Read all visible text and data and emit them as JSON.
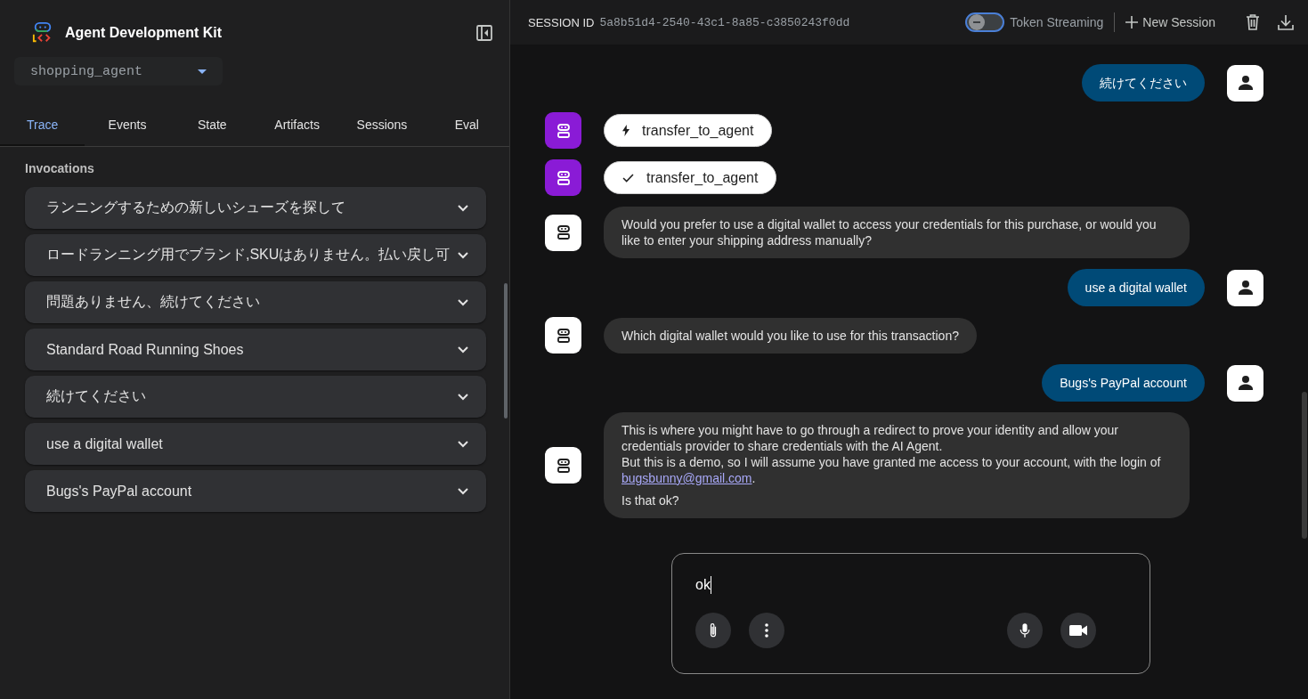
{
  "sidebar": {
    "title": "Agent Development Kit",
    "agent_select": {
      "value": "shopping_agent"
    },
    "tabs": [
      {
        "label": "Trace",
        "selected": true
      },
      {
        "label": "Events",
        "selected": false
      },
      {
        "label": "State",
        "selected": false
      },
      {
        "label": "Artifacts",
        "selected": false
      },
      {
        "label": "Sessions",
        "selected": false
      },
      {
        "label": "Eval",
        "selected": false
      }
    ],
    "section_title": "Invocations",
    "invocations": [
      {
        "label": "ランニングするための新しいシューズを探して",
        "expanded": false
      },
      {
        "label": "ロードランニング用でブランド,SKUはありません。払い戻し可",
        "expanded": false
      },
      {
        "label": "問題ありません、続けてください",
        "expanded": false
      },
      {
        "label": "Standard Road Running Shoes",
        "expanded": false
      },
      {
        "label": "続けてください",
        "expanded": false
      },
      {
        "label": "use a digital wallet",
        "expanded": false
      },
      {
        "label": "Bugs's PayPal account",
        "expanded": false
      }
    ]
  },
  "header": {
    "session_label": "SESSION ID",
    "session_id": "5a8b51d4-2540-43c1-8a85-c3850243f0dd",
    "token_streaming": {
      "label": "Token Streaming",
      "on": false
    },
    "new_session": "New Session"
  },
  "messages": [
    {
      "kind": "user",
      "paragraphs": [
        {
          "text": "続けてください"
        }
      ]
    },
    {
      "kind": "tool_call",
      "paragraphs": [
        {
          "text": "transfer_to_agent"
        }
      ]
    },
    {
      "kind": "tool_result",
      "paragraphs": [
        {
          "text": "transfer_to_agent"
        }
      ]
    },
    {
      "kind": "agent",
      "paragraphs": [
        {
          "text": "Would you prefer to use a digital wallet to access your credentials for this purchase, or would you like to enter your shipping address manually?"
        }
      ]
    },
    {
      "kind": "user",
      "paragraphs": [
        {
          "text": "use a digital wallet"
        }
      ]
    },
    {
      "kind": "agent",
      "paragraphs": [
        {
          "text": "Which digital wallet would you like to use for this transaction?"
        }
      ]
    },
    {
      "kind": "user",
      "paragraphs": [
        {
          "text": "Bugs's PayPal account"
        }
      ]
    },
    {
      "kind": "agent",
      "paragraphs": [
        {
          "text": "This is where you might have to go through a redirect to prove your identity and allow your credentials provider to share credentials with the AI Agent."
        },
        {
          "text": "But this is a demo, so I will assume you have granted me access to your account, with the login of ",
          "link": "bugsbunny@gmail.com",
          "after": "."
        },
        {
          "text": "Is that ok?"
        }
      ]
    }
  ],
  "composer": {
    "value": "ok"
  }
}
